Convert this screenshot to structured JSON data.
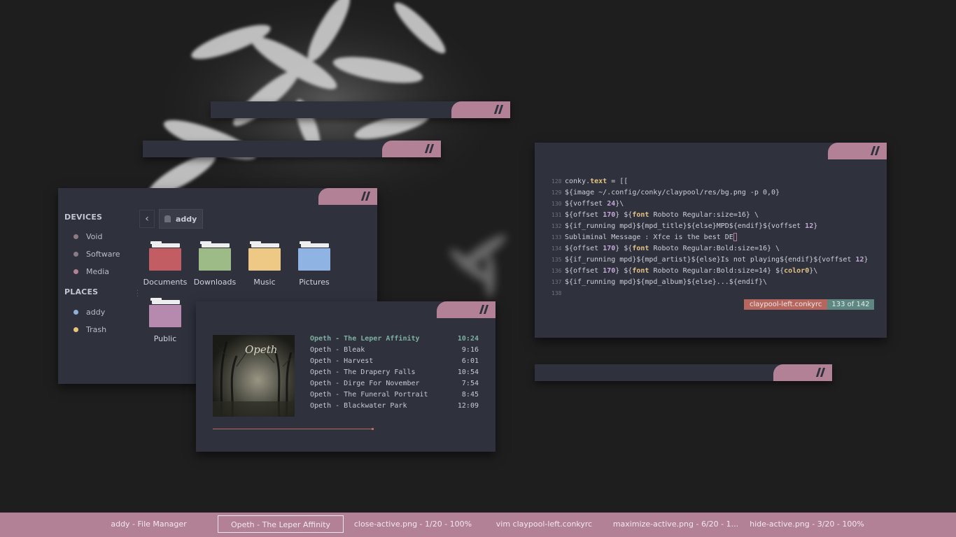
{
  "file_manager": {
    "devices_heading": "DEVICES",
    "devices": [
      {
        "label": "Void",
        "icon": "drive-icon",
        "color": "#8a7a86"
      },
      {
        "label": "Software",
        "icon": "drive-icon",
        "color": "#8a7a86"
      },
      {
        "label": "Media",
        "icon": "drive-icon",
        "color": "#b28196"
      }
    ],
    "places_heading": "PLACES",
    "places": [
      {
        "label": "addy",
        "icon": "home-icon",
        "color": "#8fb0d8"
      },
      {
        "label": "Trash",
        "icon": "trash-icon",
        "color": "#e8c57c"
      }
    ],
    "path": "addy",
    "folders": [
      {
        "name": "Documents",
        "color": "#c15d63"
      },
      {
        "name": "Downloads",
        "color": "#9dbb86"
      },
      {
        "name": "Music",
        "color": "#eec986"
      },
      {
        "name": "Pictures",
        "color": "#8fb3e2"
      },
      {
        "name": "Public",
        "color": "#b58aae"
      }
    ]
  },
  "music_player": {
    "tracks": [
      {
        "title": "Opeth - The Leper Affinity",
        "duration": "10:24",
        "active": true
      },
      {
        "title": "Opeth - Bleak",
        "duration": "9:16"
      },
      {
        "title": "Opeth - Harvest",
        "duration": "6:01"
      },
      {
        "title": "Opeth - The Drapery Falls",
        "duration": "10:54"
      },
      {
        "title": "Opeth - Dirge For November",
        "duration": "7:54"
      },
      {
        "title": "Opeth - The Funeral Portrait",
        "duration": "8:45"
      },
      {
        "title": "Opeth - Blackwater Park",
        "duration": "12:09"
      }
    ],
    "album_logo": "Opeth",
    "progress_fraction": 0.6
  },
  "vim": {
    "lines": [
      {
        "num": "128",
        "parts": [
          [
            "conky.",
            ""
          ],
          [
            "text",
            "kw"
          ],
          [
            " = [[",
            ""
          ]
        ]
      },
      {
        "num": "129",
        "parts": [
          [
            "${image ~/.config/conky/claypool/res/bg.png -p 0,0}",
            ""
          ]
        ]
      },
      {
        "num": "130",
        "parts": [
          [
            "${voffset ",
            ""
          ],
          [
            "24",
            "nm"
          ],
          [
            "}\\",
            ""
          ]
        ]
      },
      {
        "num": "131",
        "parts": [
          [
            "${offset ",
            ""
          ],
          [
            "170",
            "nm"
          ],
          [
            "} ${",
            ""
          ],
          [
            "font",
            "kw"
          ],
          [
            " Roboto Regular:size=16} \\",
            ""
          ]
        ]
      },
      {
        "num": "132",
        "parts": [
          [
            "${if_running mpd}${mpd_title}${else}MPD${endif}${voffset ",
            ""
          ],
          [
            "12",
            "nm"
          ],
          [
            "}",
            ""
          ]
        ]
      },
      {
        "num": "133",
        "parts": [
          [
            "Subliminal Message : Xfce is the best DE",
            ""
          ]
        ],
        "cursor": true
      },
      {
        "num": "134",
        "parts": [
          [
            "${offset ",
            ""
          ],
          [
            "170",
            "nm"
          ],
          [
            "} ${",
            ""
          ],
          [
            "font",
            "kw"
          ],
          [
            " Roboto Regular:Bold:size=16} \\",
            ""
          ]
        ]
      },
      {
        "num": "135",
        "parts": [
          [
            "${if_running mpd}${mpd_artist}${else}Is not playing${endif}${voffset ",
            ""
          ],
          [
            "12",
            "nm"
          ],
          [
            "}",
            ""
          ]
        ]
      },
      {
        "num": "136",
        "parts": [
          [
            "${offset ",
            ""
          ],
          [
            "170",
            "nm"
          ],
          [
            "} ${",
            ""
          ],
          [
            "font",
            "kw"
          ],
          [
            " Roboto Regular:Bold:size=14} ${",
            ""
          ],
          [
            "color0",
            "kw"
          ],
          [
            "}\\",
            ""
          ]
        ]
      },
      {
        "num": "137",
        "parts": [
          [
            "${if_running mpd}${mpd_album}${else}...${endif}\\",
            ""
          ]
        ]
      },
      {
        "num": "138",
        "parts": []
      }
    ],
    "status_file": "claypool-left.conkyrc",
    "status_pos": "133 of 142"
  },
  "taskbar": {
    "tasks": [
      {
        "label": "addy - File Manager"
      },
      {
        "label": "Opeth - The Leper Affinity",
        "current": true
      },
      {
        "label": "close-active.png - 1/20 - 100%"
      },
      {
        "label": "vim claypool-left.conkyrc"
      },
      {
        "label": "maximize-active.png - 6/20 - 1..."
      },
      {
        "label": "hide-active.png - 3/20 - 100%"
      }
    ]
  },
  "colors": {
    "accent": "#b28196",
    "window_bg": "#2f323d",
    "desktop_bg": "#1e1e1e"
  }
}
